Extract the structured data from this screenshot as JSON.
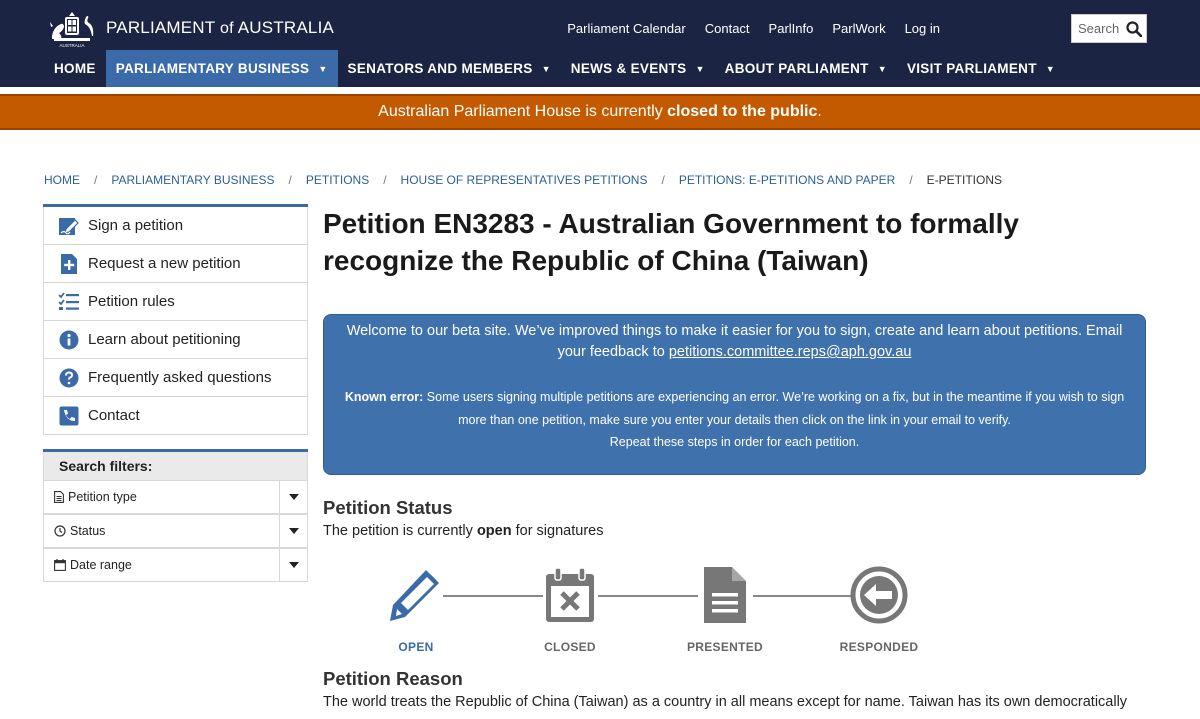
{
  "header": {
    "logo_text_1": "PARLIAMENT",
    "logo_text_of": "of",
    "logo_text_2": "AUSTRALIA",
    "crest_caption": "AUSTRALIA",
    "utility_links": [
      "Parliament Calendar",
      "Contact",
      "ParlInfo",
      "ParlWork",
      "Log in"
    ],
    "search_placeholder": "Search",
    "nav": [
      {
        "label": "HOME"
      },
      {
        "label": "PARLIAMENTARY BUSINESS"
      },
      {
        "label": "SENATORS AND MEMBERS"
      },
      {
        "label": "NEWS & EVENTS"
      },
      {
        "label": "ABOUT PARLIAMENT"
      },
      {
        "label": "VISIT PARLIAMENT"
      }
    ],
    "active_nav": "PARLIAMENTARY BUSINESS",
    "nav_color": "#1b2443",
    "active_color": "#3b6aa8"
  },
  "alert": {
    "prefix": "Australian Parliament House is currently ",
    "emphasis": "closed to the public",
    "suffix": ".",
    "color": "#c45a00"
  },
  "breadcrumb": {
    "items": [
      "HOME",
      "PARLIAMENTARY BUSINESS",
      "PETITIONS",
      "HOUSE OF REPRESENTATIVES PETITIONS",
      "PETITIONS: E-PETITIONS AND PAPER"
    ],
    "separator": "/",
    "current": "E-PETITIONS"
  },
  "sidebar": {
    "items": [
      {
        "label": "Sign a petition",
        "icon": "sign-petition-icon"
      },
      {
        "label": "Request a new petition",
        "icon": "new-document-icon"
      },
      {
        "label": "Petition rules",
        "icon": "checklist-icon"
      },
      {
        "label": "Learn about petitioning",
        "icon": "info-icon"
      },
      {
        "label": "Frequently asked questions",
        "icon": "question-icon"
      },
      {
        "label": "Contact",
        "icon": "phone-icon"
      }
    ]
  },
  "filters": {
    "heading": "Search filters:",
    "items": [
      {
        "label": "Petition type",
        "icon": "document-icon"
      },
      {
        "label": "Status",
        "icon": "clock-icon"
      },
      {
        "label": "Date range",
        "icon": "calendar-icon"
      }
    ]
  },
  "main": {
    "title": "Petition EN3283 - Australian Government to formally recognize the Republic of China (Taiwan)",
    "beta": {
      "message": "Welcome to our beta site. We’ve improved things to make it easier for you to sign, create and learn about petitions. Email your feedback to ",
      "email": "petitions.committee.reps@aph.gov.au",
      "error_label": "Known error:",
      "error_text": " Some users signing multiple petitions are experiencing an error. We’re working on a fix, but in the meantime if you wish to sign more than one petition, make sure you enter your details then click on the link in your email to verify.",
      "error_repeat": "Repeat these steps in order for each petition.",
      "color": "#3f72ad"
    },
    "status_heading": "Petition Status",
    "status_prefix": "The petition is currently ",
    "status_value": "open",
    "status_suffix": " for signatures",
    "timeline": [
      {
        "label": "OPEN",
        "icon": "pencil-icon",
        "active": true
      },
      {
        "label": "CLOSED",
        "icon": "calendar-x-icon",
        "active": false
      },
      {
        "label": "PRESENTED",
        "icon": "document-icon",
        "active": false
      },
      {
        "label": "RESPONDED",
        "icon": "arrow-left-circle-icon",
        "active": false
      }
    ],
    "reason_heading": "Petition Reason",
    "reason_text": "The world treats the Republic of China (Taiwan) as a country in all means except for name. Taiwan has its own democratically"
  }
}
